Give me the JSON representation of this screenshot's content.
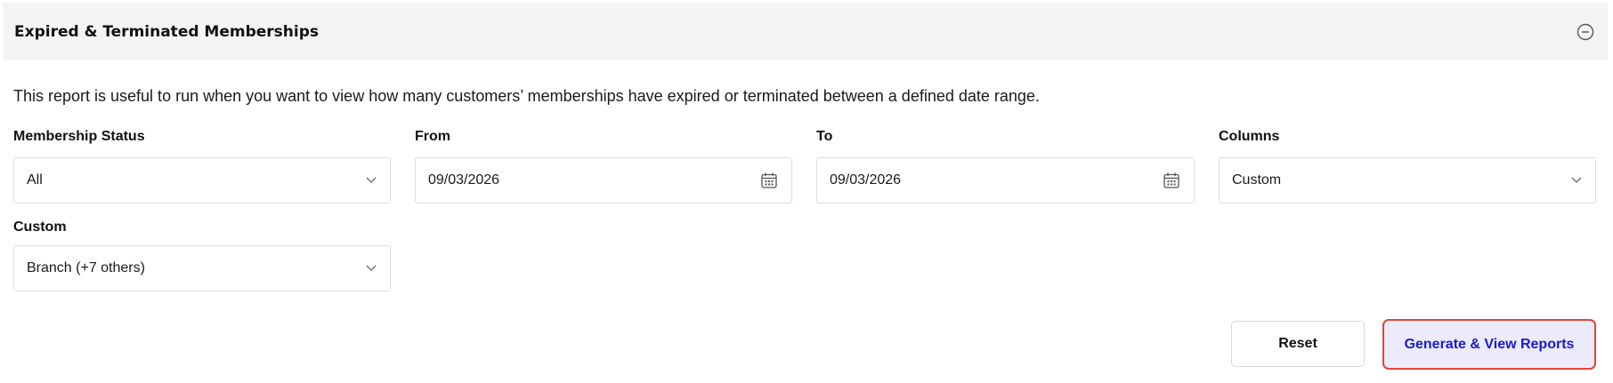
{
  "panel": {
    "title": "Expired & Terminated Memberships",
    "collapse_icon": "minus-circle-icon",
    "description": "This report is useful to run when you want to view how many customers’ memberships have expired or terminated between a defined date range."
  },
  "filters": {
    "membership_status": {
      "label": "Membership Status",
      "value": "All",
      "icon": "chevron-down-icon"
    },
    "from": {
      "label": "From",
      "value": "09/03/2026",
      "icon": "calendar-icon"
    },
    "to": {
      "label": "To",
      "value": "09/03/2026",
      "icon": "calendar-icon"
    },
    "columns": {
      "label": "Columns",
      "value": "Custom",
      "icon": "chevron-down-icon"
    },
    "custom": {
      "label": "Custom",
      "value": "Branch (+7 others)",
      "icon": "chevron-down-icon"
    }
  },
  "actions": {
    "reset_label": "Reset",
    "generate_label": "Generate & View Reports"
  },
  "colors": {
    "header_bg": "#f4f4f5",
    "generate_text": "#1a1ad1",
    "generate_bg": "#ecebfb",
    "generate_border": "#e2443a"
  }
}
